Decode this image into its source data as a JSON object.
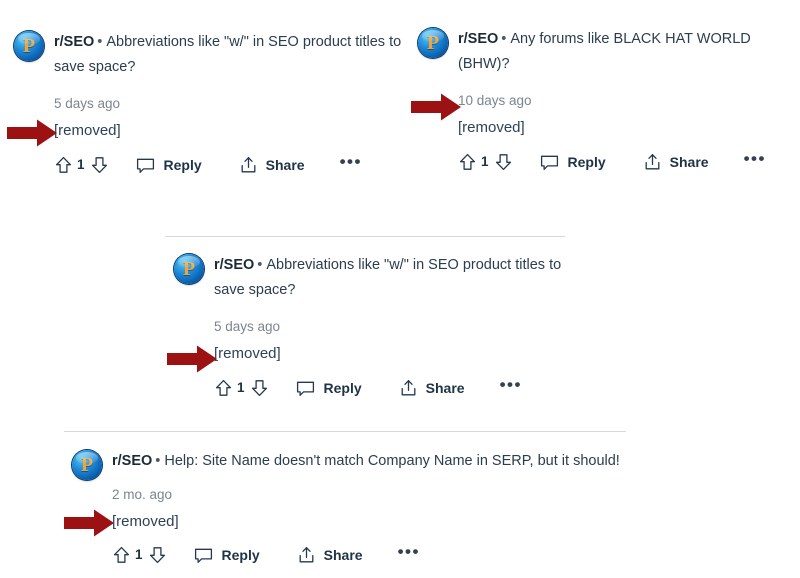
{
  "page": {
    "background": "#ffffff",
    "arrow_color": "#9c1111",
    "link_color": "#2e4257",
    "muted_color": "#7b858f"
  },
  "icons": {
    "avatar": "reddit-avatar-icon",
    "avatar_glyph": "P",
    "upvote": "upvote-arrow-icon",
    "downvote": "downvote-arrow-icon",
    "reply": "speech-bubble-icon",
    "share": "share-arrow-icon",
    "more": "overflow-menu-icon",
    "annotation": "red-pointer-arrow-icon"
  },
  "common": {
    "subreddit": "r/SEO",
    "separator": "•",
    "removed_label": "[removed]",
    "reply_label": "Reply",
    "share_label": "Share",
    "more_label": "•••"
  },
  "posts": [
    {
      "id": "post-top-left",
      "subreddit": "r/SEO",
      "title": "Abbreviations like \"w/\" in SEO product titles to save space?",
      "timestamp": "5 days ago",
      "body": "[removed]",
      "votes": "1",
      "reply_label": "Reply",
      "share_label": "Share"
    },
    {
      "id": "post-top-right",
      "subreddit": "r/SEO",
      "title": "Any forums like BLACK HAT WORLD (BHW)?",
      "timestamp": "10 days ago",
      "body": "[removed]",
      "votes": "1",
      "reply_label": "Reply",
      "share_label": "Share"
    },
    {
      "id": "post-middle",
      "subreddit": "r/SEO",
      "title": "Abbreviations like \"w/\" in SEO product titles to save space?",
      "timestamp": "5 days ago",
      "body": "[removed]",
      "votes": "1",
      "reply_label": "Reply",
      "share_label": "Share"
    },
    {
      "id": "post-bottom",
      "subreddit": "r/SEO",
      "title": "Help: Site Name doesn't match Company Name in SERP, but it should!",
      "timestamp": "2 mo. ago",
      "body": "[removed]",
      "votes": "1",
      "reply_label": "Reply",
      "share_label": "Share"
    }
  ]
}
